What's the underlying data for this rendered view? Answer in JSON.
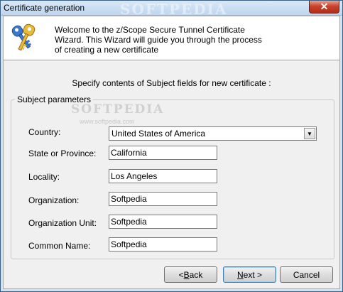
{
  "window": {
    "title": "Certificate generation",
    "watermark": "SOFTPEDIA",
    "close_glyph": "✕"
  },
  "header": {
    "icon": "keys-icon",
    "lines": [
      "Welcome to the z/Scope Secure Tunnel Certificate",
      "Wizard. This Wizard will guide you through the process",
      "of creating a new certificate"
    ]
  },
  "panel": {
    "instruction": "Specify contents of Subject fields for new certificate :",
    "group_title": "Subject parameters",
    "watermark": "SOFTPEDIA",
    "watermark_url": "www.softpedia.com",
    "fields": {
      "country": {
        "label": "Country:",
        "value": "United States of America"
      },
      "state": {
        "label": "State or Province:",
        "value": "California"
      },
      "locality": {
        "label": "Locality:",
        "value": "Los Angeles"
      },
      "organization": {
        "label": "Organization:",
        "value": "Softpedia"
      },
      "org_unit": {
        "label": "Organization Unit:",
        "value": "Softpedia"
      },
      "common_name": {
        "label": "Common Name:",
        "value": "Softpedia"
      }
    }
  },
  "buttons": {
    "back_prefix": "< ",
    "back_mnemonic": "B",
    "back_rest": "ack",
    "next_mnemonic": "N",
    "next_rest": "ext >",
    "cancel": "Cancel"
  },
  "colors": {
    "frame": "#cfe2f4",
    "dialog_bg": "#f0f0f0",
    "close_red": "#c8432d"
  }
}
